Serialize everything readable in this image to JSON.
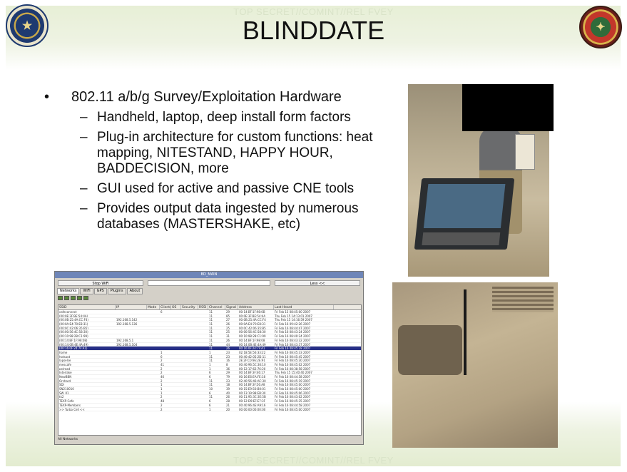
{
  "header": {
    "classification_top": "TOP SECRET//COMINT//REL FVEY",
    "title": "BLINDDATE",
    "classification_bottom": "TOP SECRET//COMINT//REL FVEY"
  },
  "bullets": {
    "main": "802.11 a/b/g Survey/Exploitation Hardware",
    "subs": [
      "Handheld, laptop, deep install form factors",
      "Plug-in architecture for custom functions: heat mapping, NITESTAND, HAPPY HOUR, BADDECISION, more",
      "GUI used for active and passive CNE tools",
      "Provides output data ingested by numerous databases (MASTERSHAKE, etc)"
    ]
  },
  "gui": {
    "title": "BD_MAIN",
    "start_button": "Stop WiFi",
    "right_button": "Less <<",
    "tabs": [
      "Networks",
      "WiFi",
      "GPS",
      "Plugins",
      "About"
    ],
    "columns": [
      "SSID",
      "IP",
      "Mode",
      "Clients",
      "OS",
      "Security",
      "RSSI",
      "Channel",
      "Signal",
      "Address",
      "Last Heard"
    ],
    "rows": [
      [
        "cafeconnect",
        "",
        "",
        "6",
        "",
        "",
        "",
        "11",
        "29",
        "00:14:BF:1F:98:0B",
        "Fri Feb 15 08:45:00 2007"
      ],
      [
        "(00:0E:3F:BE:54:4A)",
        "",
        "",
        "",
        "",
        "",
        "",
        "11",
        "85",
        "00:0E:3F:BE:54:4A",
        "Thu Feb 15 14:13:01 2007"
      ],
      [
        "(00:0B:25:4A:CC:F4)",
        "192.168.5.142",
        "",
        "",
        "",
        "",
        "",
        "11",
        "27",
        "00:0B:25:4A:CC:F4",
        "Thu Feb 15 14:16:59 2007"
      ],
      [
        "(00:0A:E4:70:E8:31)",
        "192.168.5.136",
        "",
        "",
        "",
        "",
        "",
        "11",
        "26",
        "00:0A:E4:70:E8:31",
        "Fri Feb 16 09:42:26 2007"
      ],
      [
        "(00:0C:42:06:35:B5)",
        "",
        "",
        "",
        "",
        "",
        "",
        "11",
        "25",
        "00:0C:42:06:35:B5",
        "Fri Feb 16 08:44:47 2007"
      ],
      [
        "(00:00:56:4C:58:30)",
        "",
        "",
        "",
        "",
        "",
        "",
        "11",
        "25",
        "00:00:56:4C:58:30",
        "Fri Feb 16 08:43:24 2007"
      ],
      [
        "(00:10:98:28:C1:99)",
        "",
        "",
        "",
        "",
        "",
        "",
        "11",
        "31",
        "00:10:98:28:C1:99",
        "Fri Feb 16 08:40:24 2007"
      ],
      [
        "(00:14:BF:1F:98:08)",
        "192.168.5.1",
        "",
        "",
        "",
        "",
        "",
        "11",
        "26",
        "00:14:BF:1F:98:08",
        "Fri Feb 16 08:43:32 2007"
      ],
      [
        "(00:14:0B:4E:4A:49)",
        "192.168.5.104",
        "",
        "",
        "",
        "",
        "",
        "11",
        "44",
        "00:14:0B:4E:4A:49",
        "Fri Feb 16 08:43:37 2007"
      ],
      [
        "(00:16:0F:24:7F:A1)",
        "",
        "",
        "",
        "",
        "",
        "",
        "11",
        "26",
        "00:16:0F:24:7F:A1",
        "Fri Feb 16 08:45:28 2007"
      ],
      [
        "home",
        "",
        "",
        "1",
        "",
        "",
        "",
        "1",
        "23",
        "02:18:5E:56:33:22",
        "Fri Feb 16 08:45:33 2007"
      ],
      [
        "hotspot",
        "",
        "",
        "6",
        "",
        "",
        "",
        "11",
        "23",
        "00:40:42:05:2D:11",
        "Fri Feb 16 08:45:45 2007"
      ],
      [
        "lapselse",
        "",
        "",
        "2",
        "",
        "",
        "",
        "11",
        "16",
        "2E:2F:C0:9E:2E:91",
        "Fri Feb 16 08:45:30 2007"
      ],
      [
        "mescafe",
        "",
        "",
        "41",
        "",
        "",
        "",
        "1",
        "8",
        "00:40:96:5C:30:10",
        "Fri Feb 16 08:45:02 2007"
      ],
      [
        "pelread",
        "",
        "",
        "2",
        "",
        "",
        "",
        "1",
        "36",
        "00:12:17:62:76:20",
        "Fri Feb 16 08:38:58 2007"
      ],
      [
        "Interlake",
        "",
        "",
        "2",
        "",
        "",
        "",
        "6",
        "29",
        "00:14:BF:3F:46:17",
        "Thu Feb 15 15:40:40 2007"
      ],
      [
        "NewBBN",
        "",
        "",
        "46",
        "",
        "",
        "",
        "6",
        "79",
        "00:16:E6:EA:FE:18",
        "Fri Feb 16 08:44:58 2007"
      ],
      [
        "Orchard",
        "",
        "",
        "2",
        "",
        "",
        "",
        "11",
        "23",
        "02:40:56:46:AC:30",
        "Fri Feb 16 08:45:19 2007"
      ],
      [
        "SDI",
        "",
        "",
        "1",
        "",
        "",
        "",
        "11",
        "18",
        "00:14:BF:3F:56:A8",
        "Fri Feb 16 08:45:00 2007"
      ],
      [
        "SN210010",
        "",
        "",
        "1",
        "",
        "",
        "",
        "10",
        "39",
        "00:15:E9:50:B0:01",
        "Fri Feb 16 08:45:00 2007"
      ],
      [
        "SW_01",
        "",
        "",
        "1",
        "",
        "",
        "",
        "6",
        "40",
        "00:13:19:98:EB:30",
        "Fri Feb 16 08:45:06 2007"
      ],
      [
        "tk2",
        "",
        "",
        "2",
        "",
        "",
        "",
        "11",
        "26",
        "00:11:95:3C:3E:5B",
        "Fri Feb 16 08:43:02 2007"
      ],
      [
        "TEXP-Cafe",
        "",
        "",
        "48",
        "",
        "",
        "",
        "6",
        "28",
        "00:12:D9:EF:E7:3F",
        "Fri Feb 16 08:45:35 2007"
      ],
      [
        "TEXP-Members",
        "",
        "",
        "2",
        "",
        "",
        "",
        "6",
        "21",
        "00:40:96:4E:A9:16",
        "Fri Feb 16 08:44:58 2007"
      ],
      [
        ">> Turbo Cell <<",
        "",
        "",
        "2",
        "",
        "",
        "",
        "1",
        "20",
        "00:00:00:00:00:00",
        "Fri Feb 16 08:45:00 2007"
      ]
    ],
    "selected_row": 9,
    "status": "All Networks"
  }
}
